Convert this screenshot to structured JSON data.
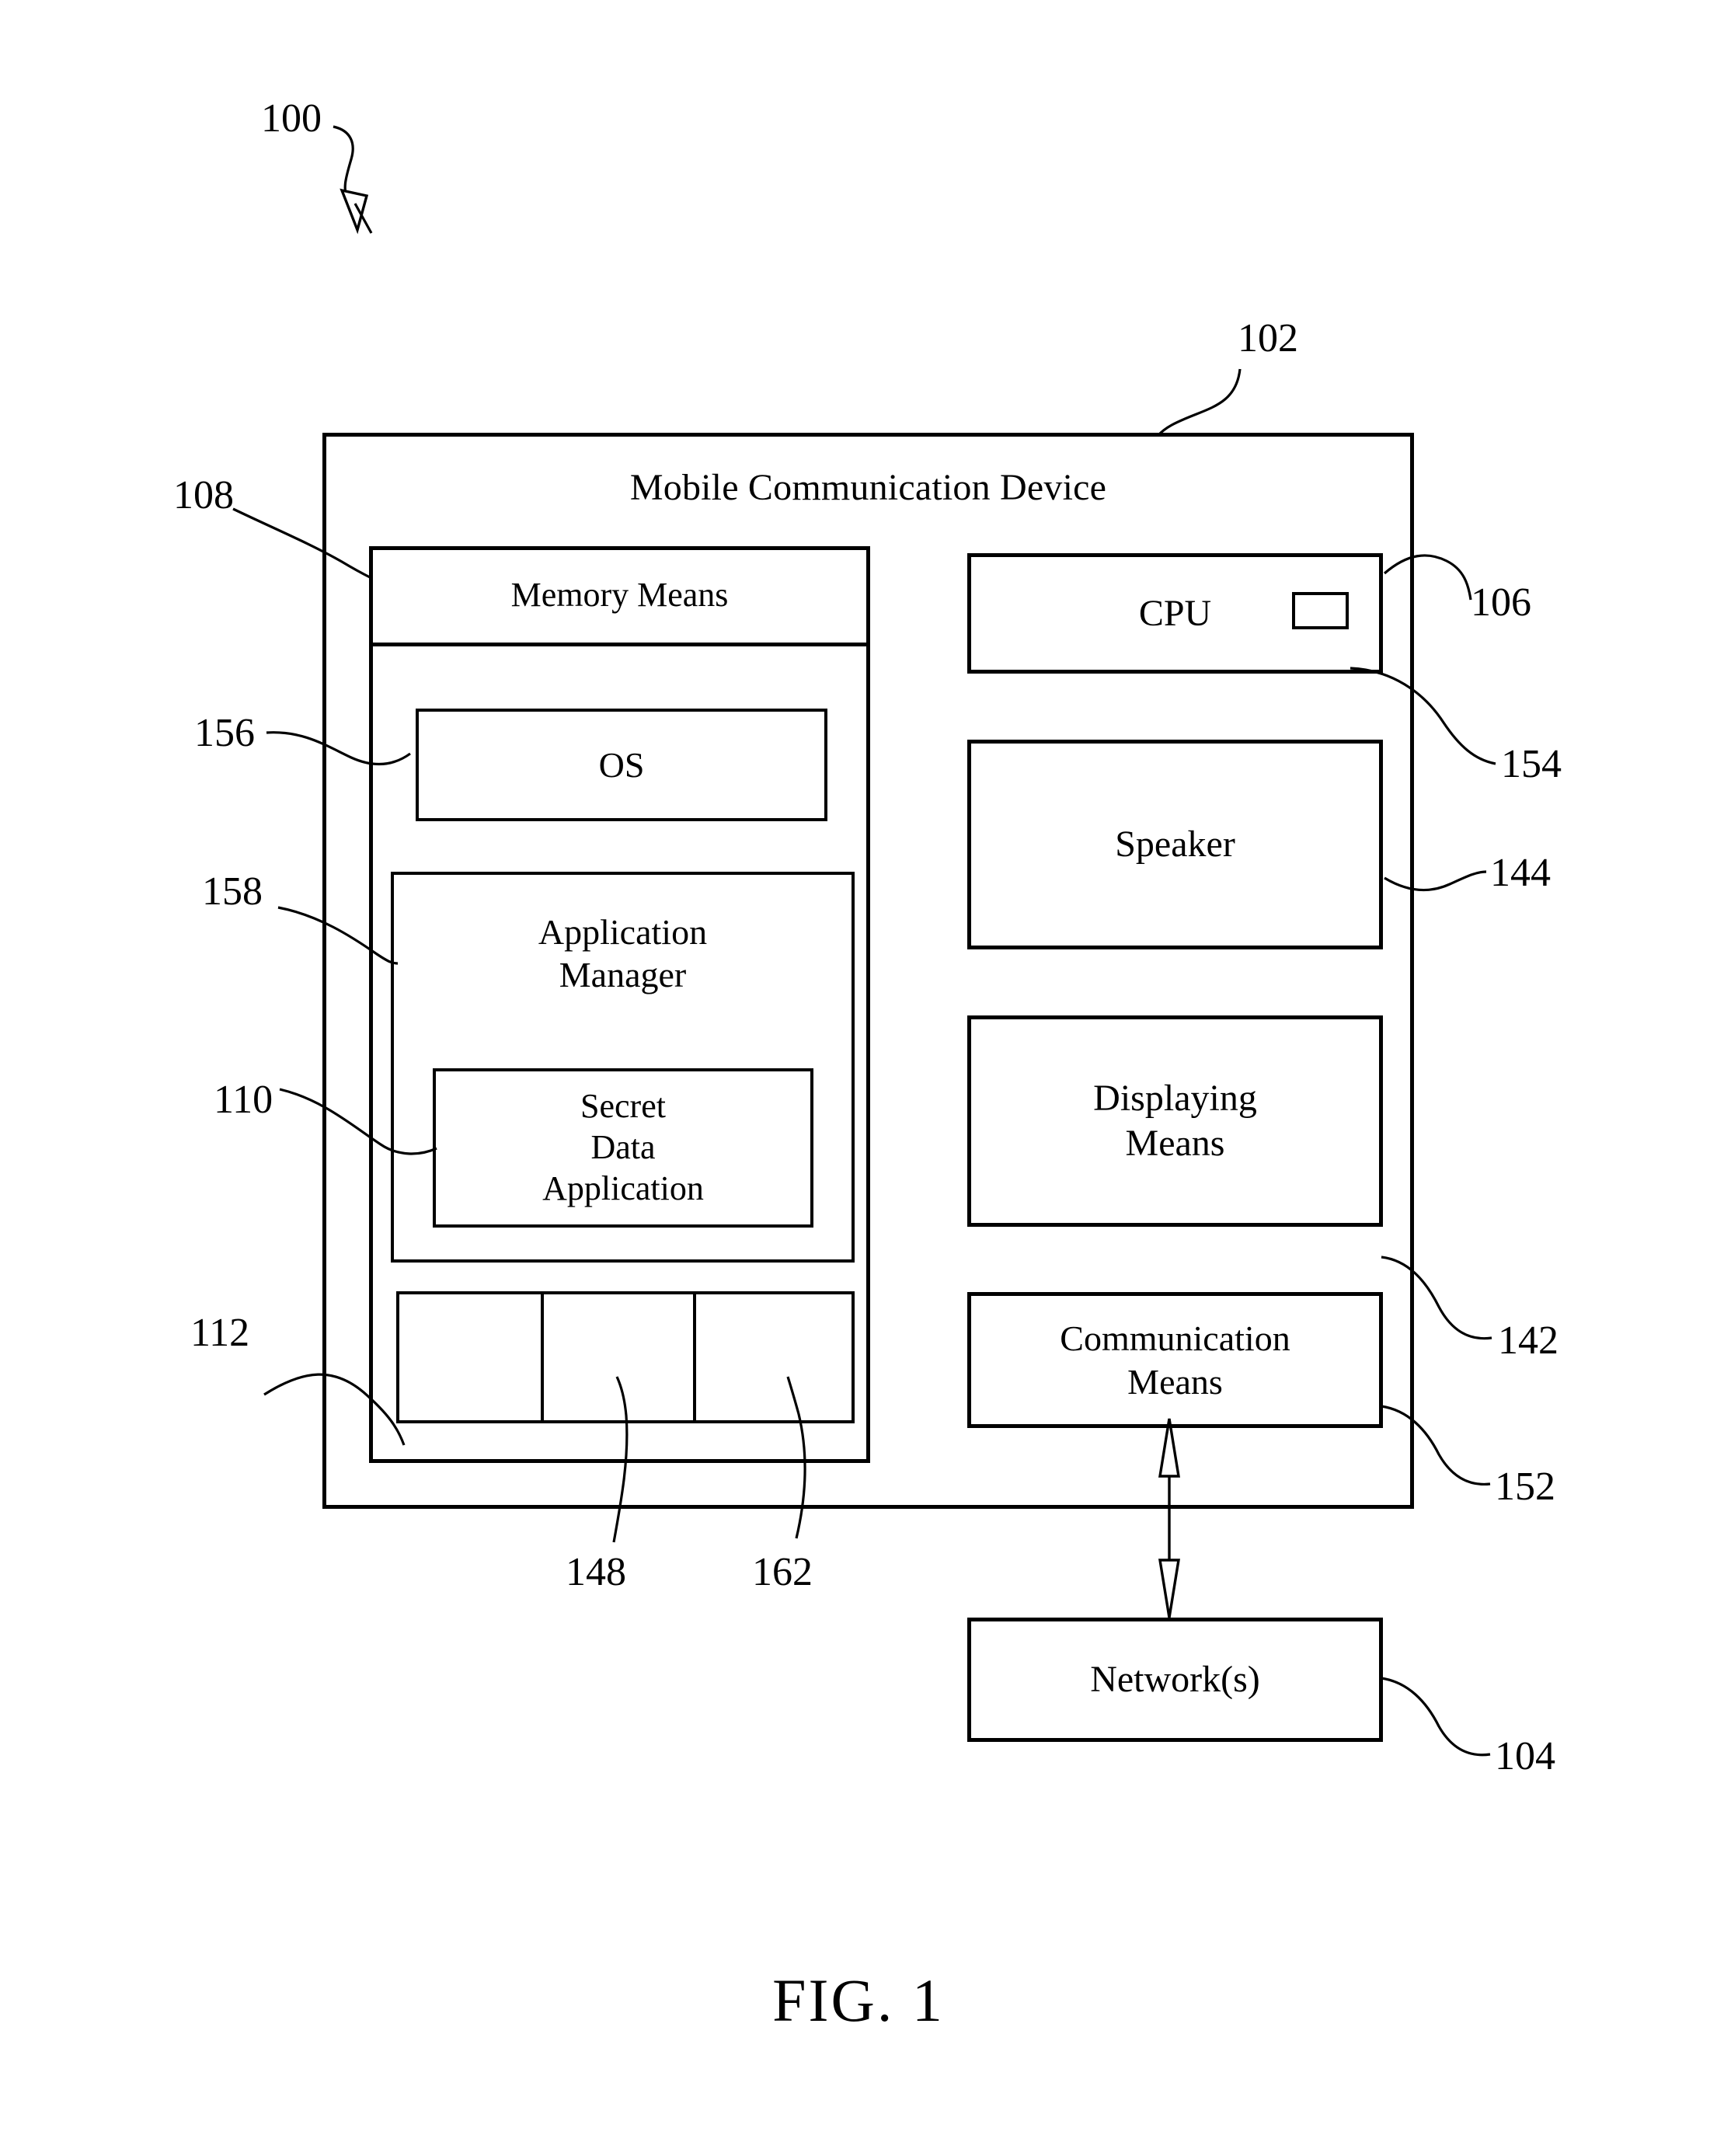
{
  "figure": {
    "caption": "FIG. 1",
    "system_numeral": "100"
  },
  "device": {
    "numeral": "102",
    "title": "Mobile Communication Device"
  },
  "memory": {
    "numeral": "108",
    "title": "Memory Means",
    "os": {
      "numeral": "156",
      "label": "OS"
    },
    "application_manager": {
      "numeral": "158",
      "label": "Application\nManager",
      "secret_data_application": {
        "numeral": "110",
        "label": "Secret\nData\nApplication"
      }
    },
    "cells": [
      {
        "numeral": "112",
        "label": ""
      },
      {
        "numeral": "148",
        "label": ""
      },
      {
        "numeral": "162",
        "label": ""
      }
    ]
  },
  "components": {
    "cpu": {
      "numeral": "106",
      "label": "CPU",
      "inner_element": {
        "numeral": "154",
        "label": ""
      }
    },
    "speaker": {
      "numeral": "144",
      "label": "Speaker"
    },
    "displaying_means": {
      "numeral": "142",
      "label": "Displaying\nMeans"
    },
    "communication_means": {
      "numeral": "152",
      "label": "Communication\nMeans"
    }
  },
  "network": {
    "numeral": "104",
    "label": "Network(s)"
  }
}
